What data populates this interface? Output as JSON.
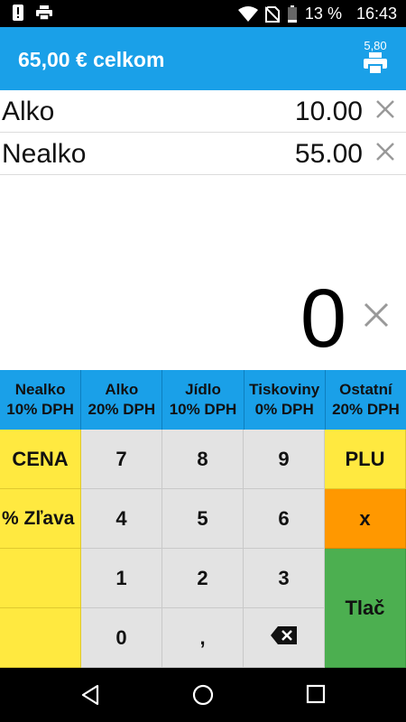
{
  "status_bar": {
    "battery_text": "13 %",
    "time": "16:43",
    "icons": [
      "alert-icon",
      "printer-notify-icon",
      "wifi-icon",
      "no-sim-icon",
      "battery-icon"
    ]
  },
  "header": {
    "title": "65,00 € celkom",
    "print_price": "5,80",
    "print_icon": "printer-icon"
  },
  "items": [
    {
      "name": "Alko",
      "amount": "10.00"
    },
    {
      "name": "Nealko",
      "amount": "55.00"
    }
  ],
  "display": {
    "value": "0"
  },
  "categories": [
    {
      "name": "Nealko",
      "vat": "10% DPH"
    },
    {
      "name": "Alko",
      "vat": "20% DPH"
    },
    {
      "name": "Jídlo",
      "vat": "10% DPH"
    },
    {
      "name": "Tiskoviny",
      "vat": "0% DPH"
    },
    {
      "name": "Ostatní",
      "vat": "20% DPH"
    }
  ],
  "keypad": {
    "cena": "CENA",
    "zlava": "% Zľava",
    "k7": "7",
    "k8": "8",
    "k9": "9",
    "k4": "4",
    "k5": "5",
    "k6": "6",
    "k1": "1",
    "k2": "2",
    "k3": "3",
    "k0": "0",
    "comma": ",",
    "plu": "PLU",
    "multiply": "x",
    "print": "Tlač"
  },
  "colors": {
    "accent": "#1aa0e8",
    "yellow": "#ffe940",
    "orange": "#ff9800",
    "green": "#4caf50",
    "key_gray": "#e3e3e3"
  }
}
